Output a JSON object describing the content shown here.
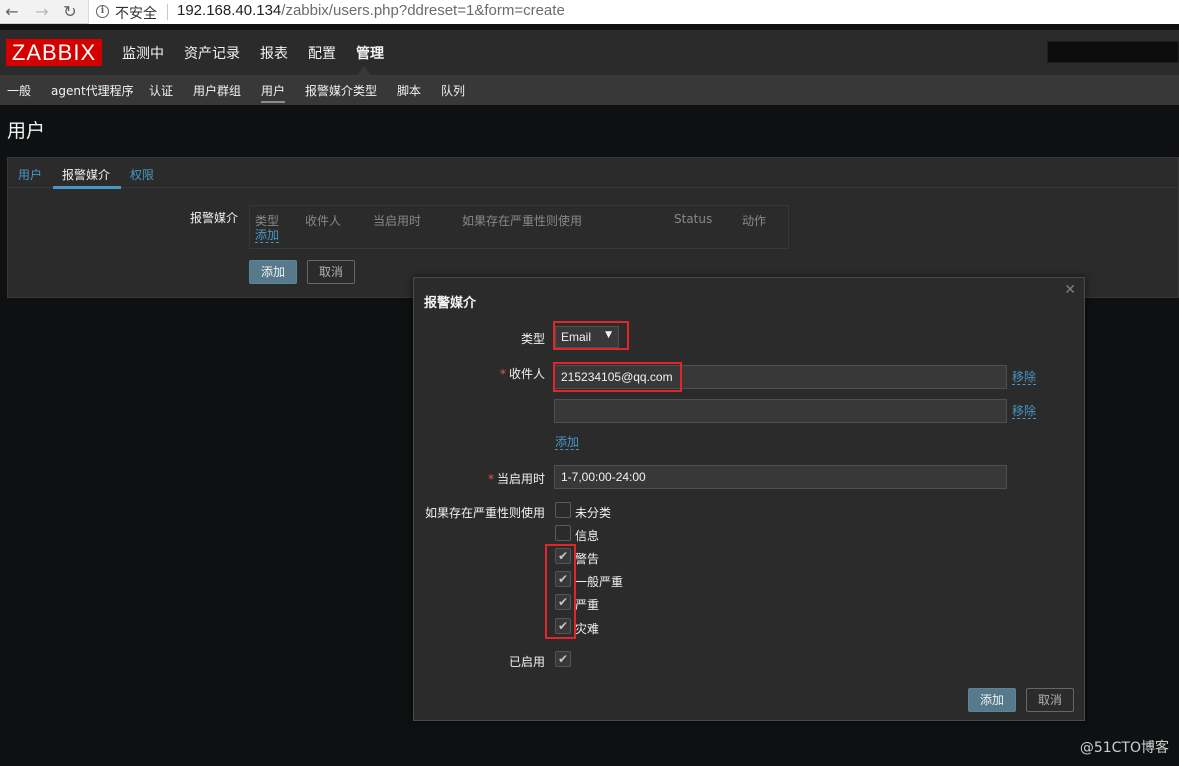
{
  "browser": {
    "back_icon": "arrow-left-icon",
    "forward_icon": "arrow-right-icon",
    "reload_icon": "reload-icon",
    "security_label": "不安全",
    "url_host": "192.168.40.134",
    "url_path": "/zabbix/users.php?ddreset=1&form=create"
  },
  "header": {
    "logo": "ZABBIX",
    "menu": [
      {
        "label": "监测中"
      },
      {
        "label": "资产记录"
      },
      {
        "label": "报表"
      },
      {
        "label": "配置"
      },
      {
        "label": "管理",
        "active": true
      }
    ],
    "submenu": [
      {
        "label": "一般"
      },
      {
        "label": "agent代理程序"
      },
      {
        "label": "认证"
      },
      {
        "label": "用户群组"
      },
      {
        "label": "用户",
        "active": true
      },
      {
        "label": "报警媒介类型"
      },
      {
        "label": "脚本"
      },
      {
        "label": "队列"
      }
    ]
  },
  "page": {
    "title": "用户",
    "tabs": [
      {
        "label": "用户"
      },
      {
        "label": "报警媒介",
        "active": true
      },
      {
        "label": "权限"
      }
    ],
    "media_label": "报警媒介",
    "media_table": {
      "columns": [
        "类型",
        "收件人",
        "当启用时",
        "如果存在严重性则使用",
        "Status",
        "动作"
      ],
      "add_link": "添加"
    },
    "add_button": "添加",
    "cancel_button": "取消"
  },
  "modal": {
    "title": "报警媒介",
    "close_icon": "close-icon",
    "type_label": "类型",
    "type_value": "Email",
    "send_to_label": "收件人",
    "send_to": [
      "215234105@qq.com",
      ""
    ],
    "remove_label": "移除",
    "add_link": "添加",
    "when_active_label": "当启用时",
    "when_active_value": "1-7,00:00-24:00",
    "severity_label": "如果存在严重性则使用",
    "severities": [
      {
        "label": "未分类",
        "checked": false
      },
      {
        "label": "信息",
        "checked": false
      },
      {
        "label": "警告",
        "checked": true
      },
      {
        "label": "一般严重",
        "checked": true
      },
      {
        "label": "严重",
        "checked": true
      },
      {
        "label": "灾难",
        "checked": true
      }
    ],
    "enabled_label": "已启用",
    "enabled": true,
    "add_button": "添加",
    "cancel_button": "取消"
  },
  "watermark": "@51CTO博客",
  "colors": {
    "accent": "#4796c4",
    "logo_red": "#d40000",
    "highlight_red": "#e0262a",
    "primary_button": "#567a8c"
  }
}
